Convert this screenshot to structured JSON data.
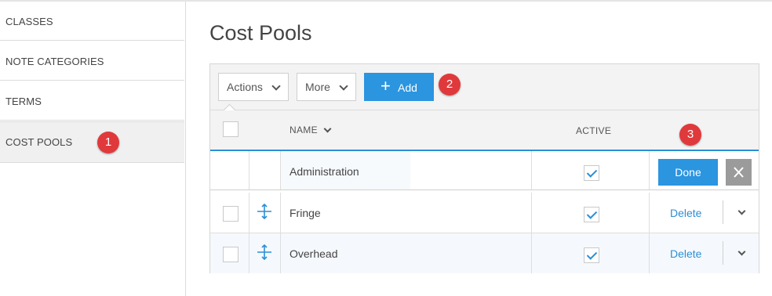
{
  "sidebar": {
    "items": [
      {
        "label": "CLASSES"
      },
      {
        "label": "NOTE CATEGORIES"
      },
      {
        "label": "TERMS"
      },
      {
        "label": "COST POOLS"
      }
    ]
  },
  "page": {
    "title": "Cost Pools"
  },
  "toolbar": {
    "actions_label": "Actions",
    "more_label": "More",
    "add_label": "Add"
  },
  "table": {
    "columns": {
      "name": "NAME",
      "active": "ACTIVE"
    },
    "rows": [
      {
        "name": "Administration",
        "active": true,
        "editing": true
      },
      {
        "name": "Fringe",
        "active": true
      },
      {
        "name": "Overhead",
        "active": true
      }
    ],
    "done_label": "Done",
    "delete_label": "Delete"
  },
  "callouts": {
    "one": "1",
    "two": "2",
    "three": "3"
  },
  "colors": {
    "accent": "#2b95e0",
    "badge": "#e0393c"
  }
}
